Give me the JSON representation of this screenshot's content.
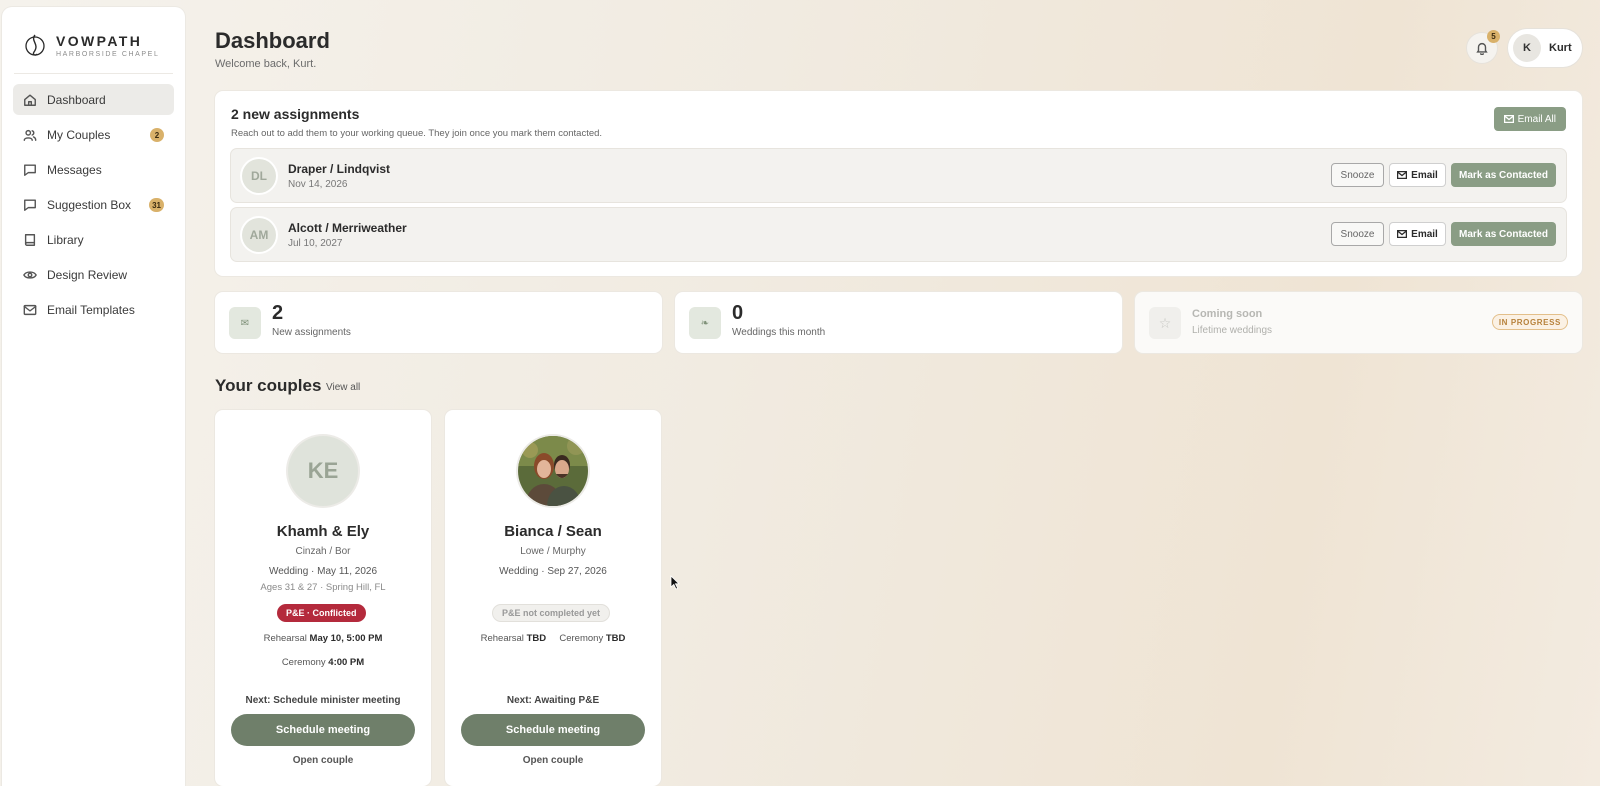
{
  "brand": {
    "name": "VOWPATH",
    "sub": "HARBORSIDE CHAPEL"
  },
  "sidebar": {
    "items": [
      {
        "label": "Dashboard",
        "icon": "home-icon",
        "active": true
      },
      {
        "label": "My Couples",
        "icon": "users-icon",
        "badge": "2"
      },
      {
        "label": "Messages",
        "icon": "message-icon"
      },
      {
        "label": "Suggestion Box",
        "icon": "message-icon",
        "badge": "31"
      },
      {
        "label": "Library",
        "icon": "book-icon"
      },
      {
        "label": "Design Review",
        "icon": "eye-icon"
      },
      {
        "label": "Email Templates",
        "icon": "mail-icon"
      }
    ]
  },
  "header": {
    "title": "Dashboard",
    "subtitle": "Welcome back, Kurt.",
    "notifications": "5",
    "user_initial": "K",
    "user_name": "Kurt"
  },
  "assignments": {
    "title": "2 new assignments",
    "description": "Reach out to add them to your working queue. They join once you mark them contacted.",
    "email_all_label": "Email All",
    "rows": [
      {
        "initials": "DL",
        "name": "Draper / Lindqvist",
        "date": "Nov 14, 2026",
        "snooze": "Snooze",
        "email": "Email",
        "contacted": "Mark as Contacted"
      },
      {
        "initials": "AM",
        "name": "Alcott / Merriweather",
        "date": "Jul 10, 2027",
        "snooze": "Snooze",
        "email": "Email",
        "contacted": "Mark as Contacted"
      }
    ]
  },
  "stats": [
    {
      "icon": "✉",
      "value": "2",
      "label": "New assignments"
    },
    {
      "icon": "❧",
      "value": "0",
      "label": "Weddings this month"
    },
    {
      "icon": "☆",
      "soon": "Coming soon",
      "label": "Lifetime weddings",
      "tag": "IN PROGRESS"
    }
  ],
  "couples_section": {
    "title": "Your couples",
    "view_all": "View all"
  },
  "couples": [
    {
      "initials": "KE",
      "name": "Khamh & Ely",
      "surnames": "Cinzah / Bor",
      "wedding": "Wedding · May 11, 2026",
      "ages": "Ages 31 & 27 · Spring Hill, FL",
      "pe_status": "P&E · Conflicted",
      "rehearsal_label": "Rehearsal",
      "rehearsal_value": "May 10, 5:00 PM",
      "ceremony_label": "Ceremony",
      "ceremony_value": "4:00 PM",
      "next": "Next: Schedule minister meeting",
      "cta": "Schedule meeting",
      "open": "Open couple"
    },
    {
      "name": "Bianca / Sean",
      "surnames": "Lowe / Murphy",
      "wedding": "Wedding · Sep 27, 2026",
      "pe_status": "P&E not completed yet",
      "rehearsal_label": "Rehearsal",
      "rehearsal_value": "TBD",
      "ceremony_label": "Ceremony",
      "ceremony_value": "TBD",
      "next": "Next: Awaiting P&E",
      "cta": "Schedule meeting",
      "open": "Open couple"
    }
  ],
  "colors": {
    "accent": "#8a9d85",
    "accent_dark": "#6f7f6a",
    "danger": "#b42a3c",
    "badge": "#d9b16a"
  }
}
